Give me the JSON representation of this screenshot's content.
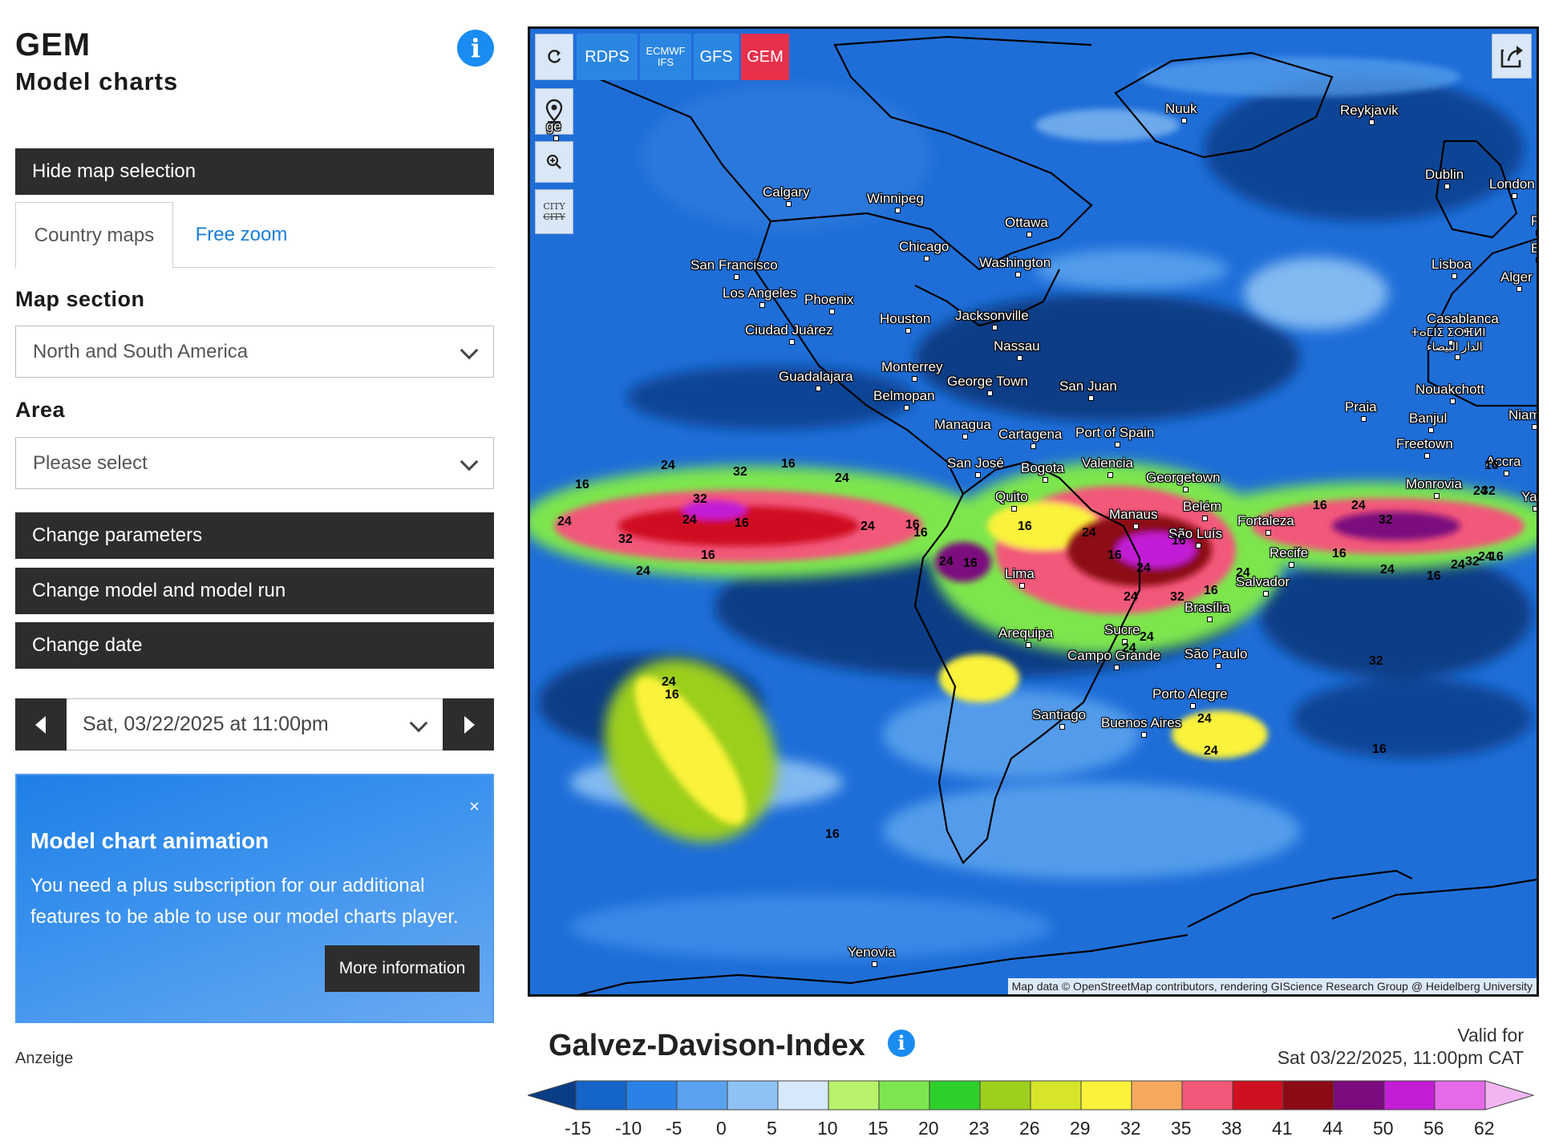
{
  "header": {
    "title": "GEM",
    "subtitle": "Model charts",
    "info_icon": "info-icon"
  },
  "left_panel": {
    "hide_map_selection": "Hide map selection",
    "tabs": [
      {
        "label": "Country maps",
        "active": true
      },
      {
        "label": "Free zoom",
        "active": false
      }
    ],
    "map_section": {
      "label": "Map section",
      "value": "North and South America"
    },
    "area": {
      "label": "Area",
      "placeholder": "Please select"
    },
    "change_parameters": "Change parameters",
    "change_model": "Change model and model run",
    "change_date": "Change date",
    "date_selector": {
      "value": "Sat, 03/22/2025 at 11:00pm"
    },
    "promo": {
      "close": "×",
      "title": "Model chart animation",
      "text": "You need a plus subscription for our additional features to be able to use our model charts player.",
      "button": "More information"
    },
    "ad_label": "Anzeige"
  },
  "map": {
    "model_buttons": [
      {
        "label": "RDPS",
        "active": false
      },
      {
        "label": "ECMWF IFS",
        "active": false
      },
      {
        "label": "GFS",
        "active": false
      },
      {
        "label": "GEM",
        "active": true
      }
    ],
    "controls": [
      "refresh-icon",
      "location-pin-icon",
      "zoom-icon",
      "city-toggle-icon",
      "share-icon"
    ],
    "city_toggle_label": "CITY",
    "cities": [
      "Nuuk",
      "Reykjavik",
      "Calgary",
      "Winnipeg",
      "Ottawa",
      "Chicago",
      "Washington",
      "San Francisco",
      "Los Angeles",
      "Phoenix",
      "Houston",
      "Jacksonville",
      "Ciudad Juárez",
      "Nassau",
      "Monterrey",
      "Guadalajara",
      "George Town",
      "San Juan",
      "Belmopan",
      "Managua",
      "Cartagena",
      "Port of Spain",
      "San José",
      "Bogota",
      "Valencia",
      "Georgetown",
      "Quito",
      "Manaus",
      "Belém",
      "Fortaleza",
      "São Luís",
      "Recife",
      "Lima",
      "Salvador",
      "Brasília",
      "Sucre",
      "Arequipa",
      "Campo Grande",
      "São Paulo",
      "Porto Alegre",
      "Santiago",
      "Buenos Aires",
      "Yenovia",
      "Dublin",
      "London",
      "Lisboa",
      "Alger",
      "Casablanca",
      "Nouakchott",
      "Praia",
      "Banjul",
      "Niamey",
      "Freetown",
      "Monrovia",
      "Accra",
      "Yac",
      "ge",
      "P",
      "B"
    ],
    "casablanca_script_1": "ⵜⴰⵎⵏⵉ ⵉⵙⴼⵍⵏ",
    "casablanca_script_2": "الدار البيضاء",
    "isoline_labels": [
      "16",
      "24",
      "32",
      "24",
      "16",
      "32",
      "24",
      "16",
      "24",
      "16",
      "32",
      "24",
      "16",
      "24",
      "16",
      "24",
      "16",
      "24",
      "32",
      "24",
      "16",
      "24",
      "32",
      "24",
      "16",
      "24",
      "16",
      "16",
      "24",
      "32",
      "24",
      "16",
      "24",
      "24",
      "16",
      "16",
      "24",
      "16",
      "32",
      "24",
      "16",
      "24",
      "32",
      "24",
      "16",
      "24",
      "16",
      "16"
    ],
    "attribution": "Map data © OpenStreetMap contributors, rendering GIScience Research Group @ Heidelberg University"
  },
  "legend": {
    "title": "Galvez-Davison-Index",
    "valid_label": "Valid for",
    "valid_value": "Sat 03/22/2025, 11:00pm CAT",
    "ticks": [
      "-15",
      "-10",
      "-5",
      "0",
      "5",
      "10",
      "15",
      "20",
      "23",
      "26",
      "29",
      "32",
      "35",
      "38",
      "41",
      "44",
      "50",
      "56",
      "62"
    ],
    "colors": [
      "#0a3d86",
      "#1565c8",
      "#2b82e6",
      "#5aa2ee",
      "#8ec2f4",
      "#d6e8fb",
      "#b8f26a",
      "#7de64e",
      "#2fcf2b",
      "#9ccf1e",
      "#d7e52a",
      "#fbf23a",
      "#f6a95e",
      "#f2587a",
      "#cf1020",
      "#8c0a16",
      "#7b0b7e",
      "#c21ed6",
      "#e56ae8",
      "#f1b6f2"
    ]
  }
}
